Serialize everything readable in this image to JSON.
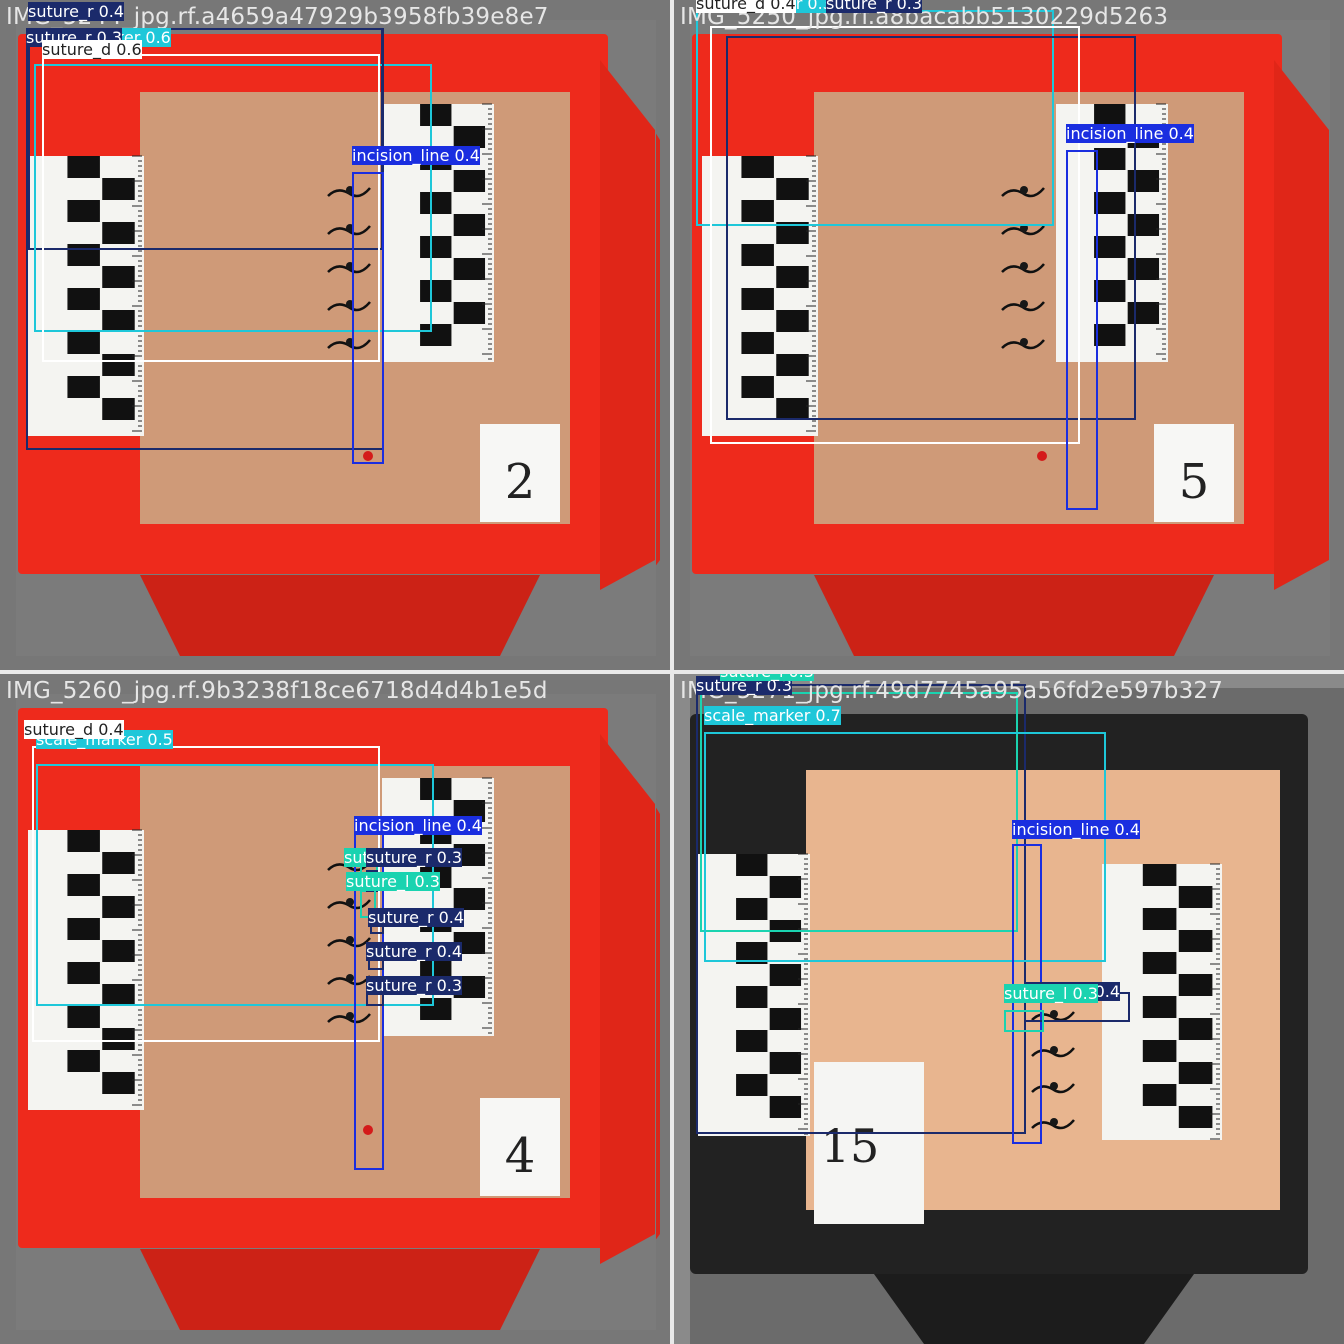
{
  "class_colors": {
    "suture_r": "#1b2a6b",
    "suture_d": "#ffffff",
    "suture_l": "#1ad3b0",
    "scale_marker": "#1ec7d9",
    "incision_line": "#1a2ee0"
  },
  "tiles": [
    {
      "filename": "IMG_5244_jpg.rf.a4659a47929b3958fb39e8e7",
      "theme": "red",
      "card_number": "2",
      "detections": [
        {
          "class": "suture_r",
          "label": "suture_r 0.4"
        },
        {
          "class": "scale_marker",
          "label": "scale_marker 0.6"
        },
        {
          "class": "suture_r",
          "label": "suture_r 0.3"
        },
        {
          "class": "suture_d",
          "label": "suture_d 0.6"
        },
        {
          "class": "incision_line",
          "label": "incision_line 0.4"
        }
      ]
    },
    {
      "filename": "IMG_5250_jpg.rf.a8bacabb5130229d5263",
      "theme": "red",
      "card_number": "5",
      "detections": [
        {
          "class": "scale_marker",
          "label": "scale_marker 0.3"
        },
        {
          "class": "suture_r",
          "label": "suture_r 0.3"
        },
        {
          "class": "suture_d",
          "label": "suture_d 0.4"
        },
        {
          "class": "incision_line",
          "label": "incision_line 0.4"
        }
      ]
    },
    {
      "filename": "IMG_5260_jpg.rf.9b3238f18ce6718d4d4b1e5d",
      "theme": "red",
      "card_number": "4",
      "detections": [
        {
          "class": "scale_marker",
          "label": "scale_marker 0.5"
        },
        {
          "class": "suture_d",
          "label": "suture_d 0.4"
        },
        {
          "class": "incision_line",
          "label": "incision_line 0.4"
        },
        {
          "class": "suture_l",
          "label": "suture_l 0.3"
        },
        {
          "class": "suture_r",
          "label": "suture_r 0.3"
        },
        {
          "class": "suture_l",
          "label": "suture_l 0.3"
        },
        {
          "class": "suture_r",
          "label": "suture_r 0.4"
        },
        {
          "class": "suture_r",
          "label": "suture_r 0.4"
        },
        {
          "class": "suture_r",
          "label": "suture_r 0.3"
        }
      ]
    },
    {
      "filename": "IMG_5271_jpg.rf.49d7745a95a56fd2e597b327",
      "theme": "black",
      "card_number": "15",
      "detections": [
        {
          "class": "suture_r",
          "label": "suture_r 0.3"
        },
        {
          "class": "suture_l",
          "label": "suture_l 0.3"
        },
        {
          "class": "scale_marker",
          "label": "scale_marker 0.7"
        },
        {
          "class": "incision_line",
          "label": "incision_line 0.4"
        },
        {
          "class": "suture_r",
          "label": "suture_r 0.4"
        },
        {
          "class": "suture_l",
          "label": "suture_l 0.3"
        }
      ]
    }
  ]
}
